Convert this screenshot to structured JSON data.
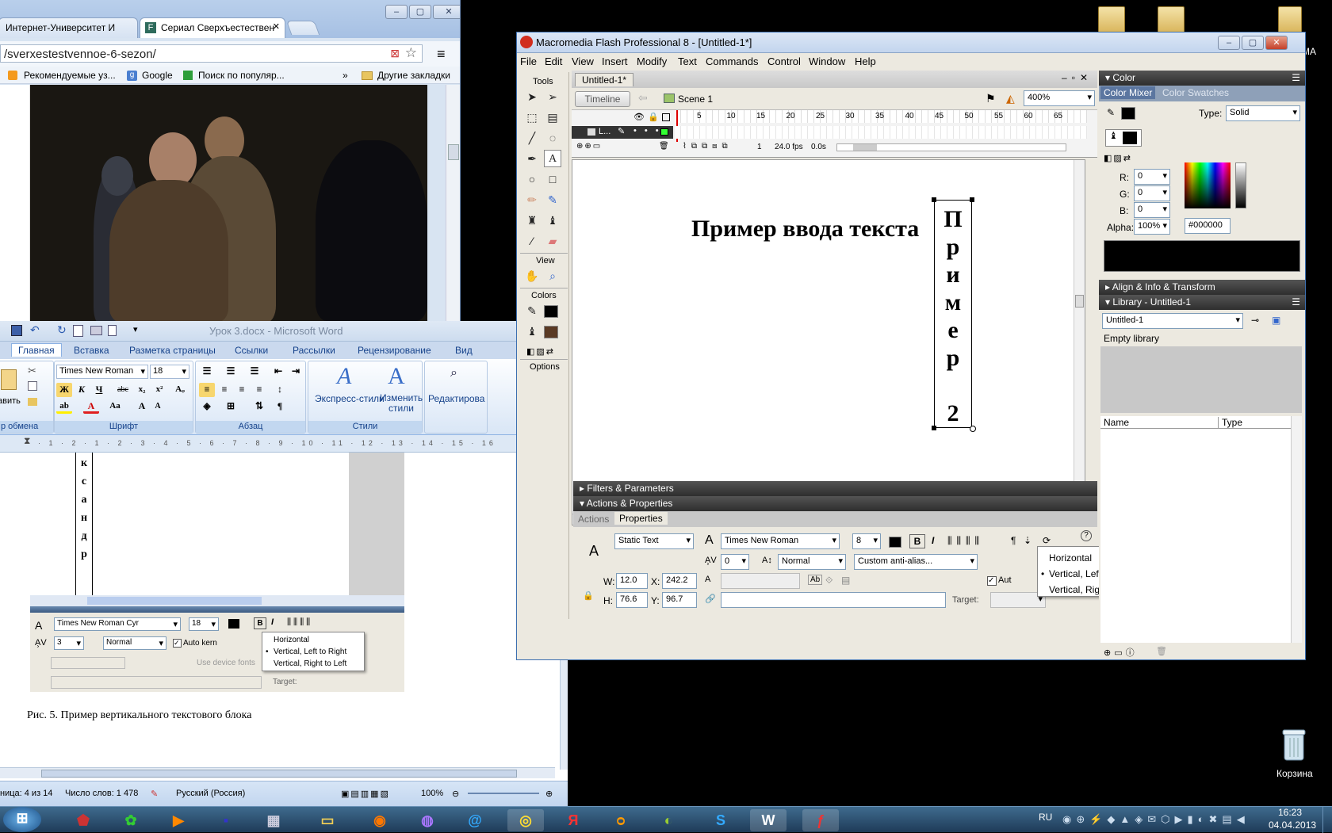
{
  "chrome": {
    "tabs": [
      "Интернет-Университет И",
      "Сериал Сверхъестествен"
    ],
    "url": "/sverxestestvennoe-6-sezon/",
    "bookmarks": [
      "Рекомендуемые уз...",
      "Google",
      "Поиск по популяр...",
      "»",
      "Другие закладки"
    ]
  },
  "word": {
    "title": "Урок 3.docx - Microsoft Word",
    "ribbon_tabs": [
      "Главная",
      "Вставка",
      "Разметка страницы",
      "Ссылки",
      "Рассылки",
      "Рецензирование",
      "Вид"
    ],
    "font_name": "Times New Roman",
    "font_size": "18",
    "styles_express": "Экспресс-стили",
    "styles_change": "Изменить стили",
    "edit_label": "Редактирова",
    "paste_label": "авить",
    "group_labels": [
      "р обмена",
      "Шрифт",
      "Абзац",
      "Стили"
    ],
    "vertical_text_letters": [
      "к",
      "с",
      "а",
      "н",
      "д",
      "р"
    ],
    "embedded": {
      "font": "Times New Roman Cyr",
      "size": "18",
      "tracking": "3",
      "kerning_mode": "Normal",
      "auto_kern": "Auto kern",
      "use_device_fonts": "Use device fonts",
      "target": "Target:",
      "popup": [
        "Horizontal",
        "Vertical, Left to Right",
        "Vertical, Right to Left"
      ],
      "popup_selected": "Vertical, Left to Right"
    },
    "caption": "Рис. 5. Пример вертикального текстового блока",
    "status": {
      "page": "ница: 4 из 14",
      "words": "Число слов: 1 478",
      "lang": "Русский (Россия)",
      "zoom": "100%"
    }
  },
  "flash": {
    "title": "Macromedia Flash Professional 8 - [Untitled-1*]",
    "menu": [
      "File",
      "Edit",
      "View",
      "Insert",
      "Modify",
      "Text",
      "Commands",
      "Control",
      "Window",
      "Help"
    ],
    "doc_tab": "Untitled-1*",
    "timeline_btn": "Timeline",
    "scene": "Scene 1",
    "zoom": "400%",
    "tools_label": "Tools",
    "view_label": "View",
    "colors_label": "Colors",
    "options_label": "Options",
    "frame_numbers": [
      "5",
      "10",
      "15",
      "20",
      "25",
      "30",
      "35",
      "40",
      "45",
      "50",
      "55",
      "60",
      "65"
    ],
    "layer_name": "L...",
    "frame": "1",
    "fps": "24.0 fps",
    "time": "0.0s",
    "stage_text": "Пример ввода текста",
    "vertical_letters": [
      "П",
      "р",
      "и",
      "м",
      "е",
      "р",
      "",
      "2"
    ],
    "panels": {
      "filters": "Filters & Parameters",
      "actions_props": "Actions & Properties",
      "tab_actions": "Actions",
      "tab_properties": "Properties"
    },
    "props": {
      "text_type": "Static Text",
      "font": "Times New Roman",
      "size": "8",
      "tracking": "0",
      "kerning": "Normal",
      "antialias": "Custom anti-alias...",
      "w_label": "W:",
      "w": "12.0",
      "x_label": "X:",
      "x": "242.2",
      "h_label": "H:",
      "h": "76.6",
      "y_label": "Y:",
      "y": "96.7",
      "auto": "Aut",
      "target": "Target:"
    },
    "popup": [
      "Horizontal",
      "Vertical, Left to Right",
      "Vertical, Right to Left"
    ],
    "popup_selected": "Vertical, Left to Right",
    "color": {
      "panel": "Color",
      "tab_mixer": "Color Mixer",
      "tab_swatches": "Color Swatches",
      "type_label": "Type:",
      "type": "Solid",
      "r_label": "R:",
      "r": "0",
      "g_label": "G:",
      "g": "0",
      "b_label": "B:",
      "b": "0",
      "alpha_label": "Alpha:",
      "alpha": "100%",
      "hex": "#000000"
    },
    "align_panel": "Align & Info & Transform",
    "library": {
      "panel": "Library - Untitled-1",
      "select": "Untitled-1",
      "empty": "Empty library",
      "col_name": "Name",
      "col_type": "Type"
    }
  },
  "desktop": {
    "recycle": "Корзина",
    "ma": "MA"
  },
  "taskbar": {
    "lang": "RU",
    "time": "16:23",
    "date": "04.04.2013"
  }
}
